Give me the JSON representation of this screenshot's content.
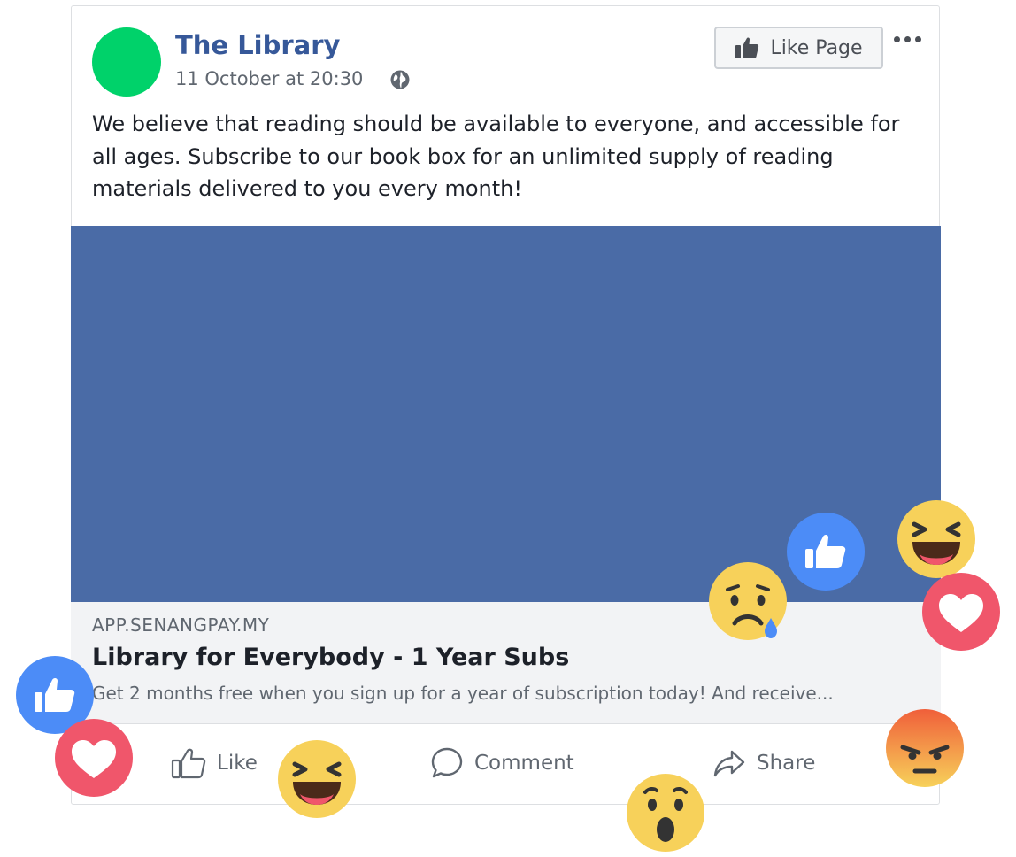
{
  "post": {
    "page_name": "The Library",
    "timestamp": "11 October at 20:30",
    "audience_icon": "globe-icon",
    "like_page_label": "Like Page",
    "more_icon": "more-options-icon",
    "text": "We believe that reading should be available to everyone, and accessible for all ages. Subscribe to our book box for an unlimited supply of reading materials delivered to you every month!"
  },
  "link": {
    "domain": "APP.SENANGPAY.MY",
    "title": "Library for Everybody - 1 Year Subs",
    "description": "Get 2 months free when you sign up for a year of subscription today! And receive..."
  },
  "actions": [
    {
      "label": "Like",
      "icon": "thumbs-up-outline-icon"
    },
    {
      "label": "Comment",
      "icon": "comment-bubble-icon"
    },
    {
      "label": "Share",
      "icon": "share-arrow-icon"
    }
  ],
  "colors": {
    "brand_blue": "#365899",
    "image_blue": "#4a6ba6",
    "avatar_green": "#00d26a",
    "reaction_like": "#4c8cf7",
    "reaction_love": "#f0566b",
    "reaction_yellow": "#f7d15a",
    "reaction_angry": "#f05f3a"
  },
  "reactions": [
    "like-reaction-icon",
    "haha-reaction-icon",
    "sad-reaction-icon",
    "love-reaction-icon",
    "wow-reaction-icon",
    "angry-reaction-icon"
  ]
}
